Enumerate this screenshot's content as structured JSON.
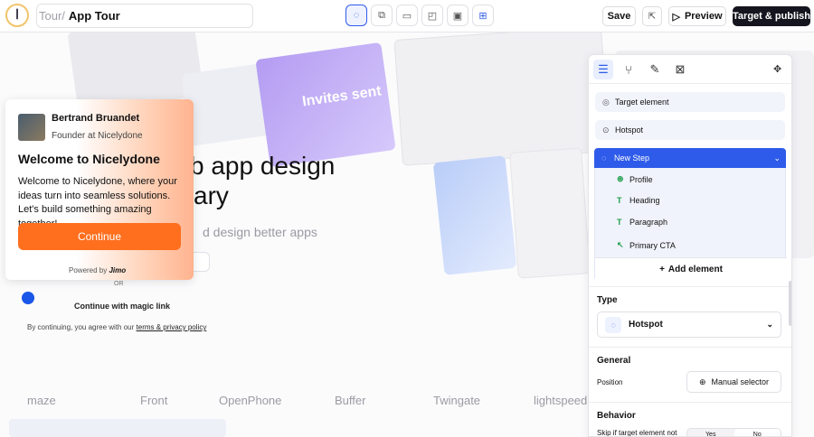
{
  "header": {
    "logo_glyph": "ꟾ",
    "crumb_parent": "Tour/",
    "crumb_title": "App Tour",
    "mode_icons": [
      "hotspot-mode-icon",
      "copy-mode-icon",
      "tooltip-mode-icon",
      "modal-mode-icon",
      "banner-mode-icon",
      "add-mode-icon"
    ],
    "save_label": "Save",
    "preview_label": "Preview",
    "publish_label": "Target & publish"
  },
  "background": {
    "invites_text": "Invites sent",
    "hero_line1": "b app design",
    "hero_line2": "ary",
    "hero_sub": "d design better apps",
    "or_text": "OR",
    "magic_link": "Continue with magic link",
    "terms_prefix": "By continuing, you agree with our ",
    "terms_link": "terms & privacy policy",
    "logos": [
      "maze",
      "Front",
      "OpenPhone",
      "Buffer",
      "Twingate",
      "lightspeed"
    ]
  },
  "tooltip": {
    "name": "Bertrand Bruandet",
    "role": "Founder at Nicelydone",
    "title": "Welcome to Nicelydone",
    "body": "Welcome to Nicelydone, where your ideas turn into seamless solutions. Let's build something amazing together!",
    "cta": "Continue",
    "powered_prefix": "Powered by ",
    "powered_brand": "Jimo",
    "cta_color": "#ff6f1e"
  },
  "panel": {
    "tabs": [
      "layers-icon",
      "flow-icon",
      "brush-icon",
      "formula-icon"
    ],
    "target_element": "Target element",
    "hotspot": "Hotspot",
    "new_step": "New Step",
    "children": [
      {
        "icon": "profile-icon",
        "label": "Profile"
      },
      {
        "icon": "text-icon",
        "label": "Heading"
      },
      {
        "icon": "text-icon",
        "label": "Paragraph"
      },
      {
        "icon": "cta-icon",
        "label": "Primary CTA"
      }
    ],
    "add_element": "Add element",
    "type_heading": "Type",
    "type_value": "Hotspot",
    "general_heading": "General",
    "position_label": "Position",
    "manual_selector": "Manual selector",
    "behavior_heading": "Behavior",
    "skip_label": "Skip if target element not",
    "seg_yes": "Yes",
    "seg_no": "No",
    "accent": "#2f5bea"
  }
}
